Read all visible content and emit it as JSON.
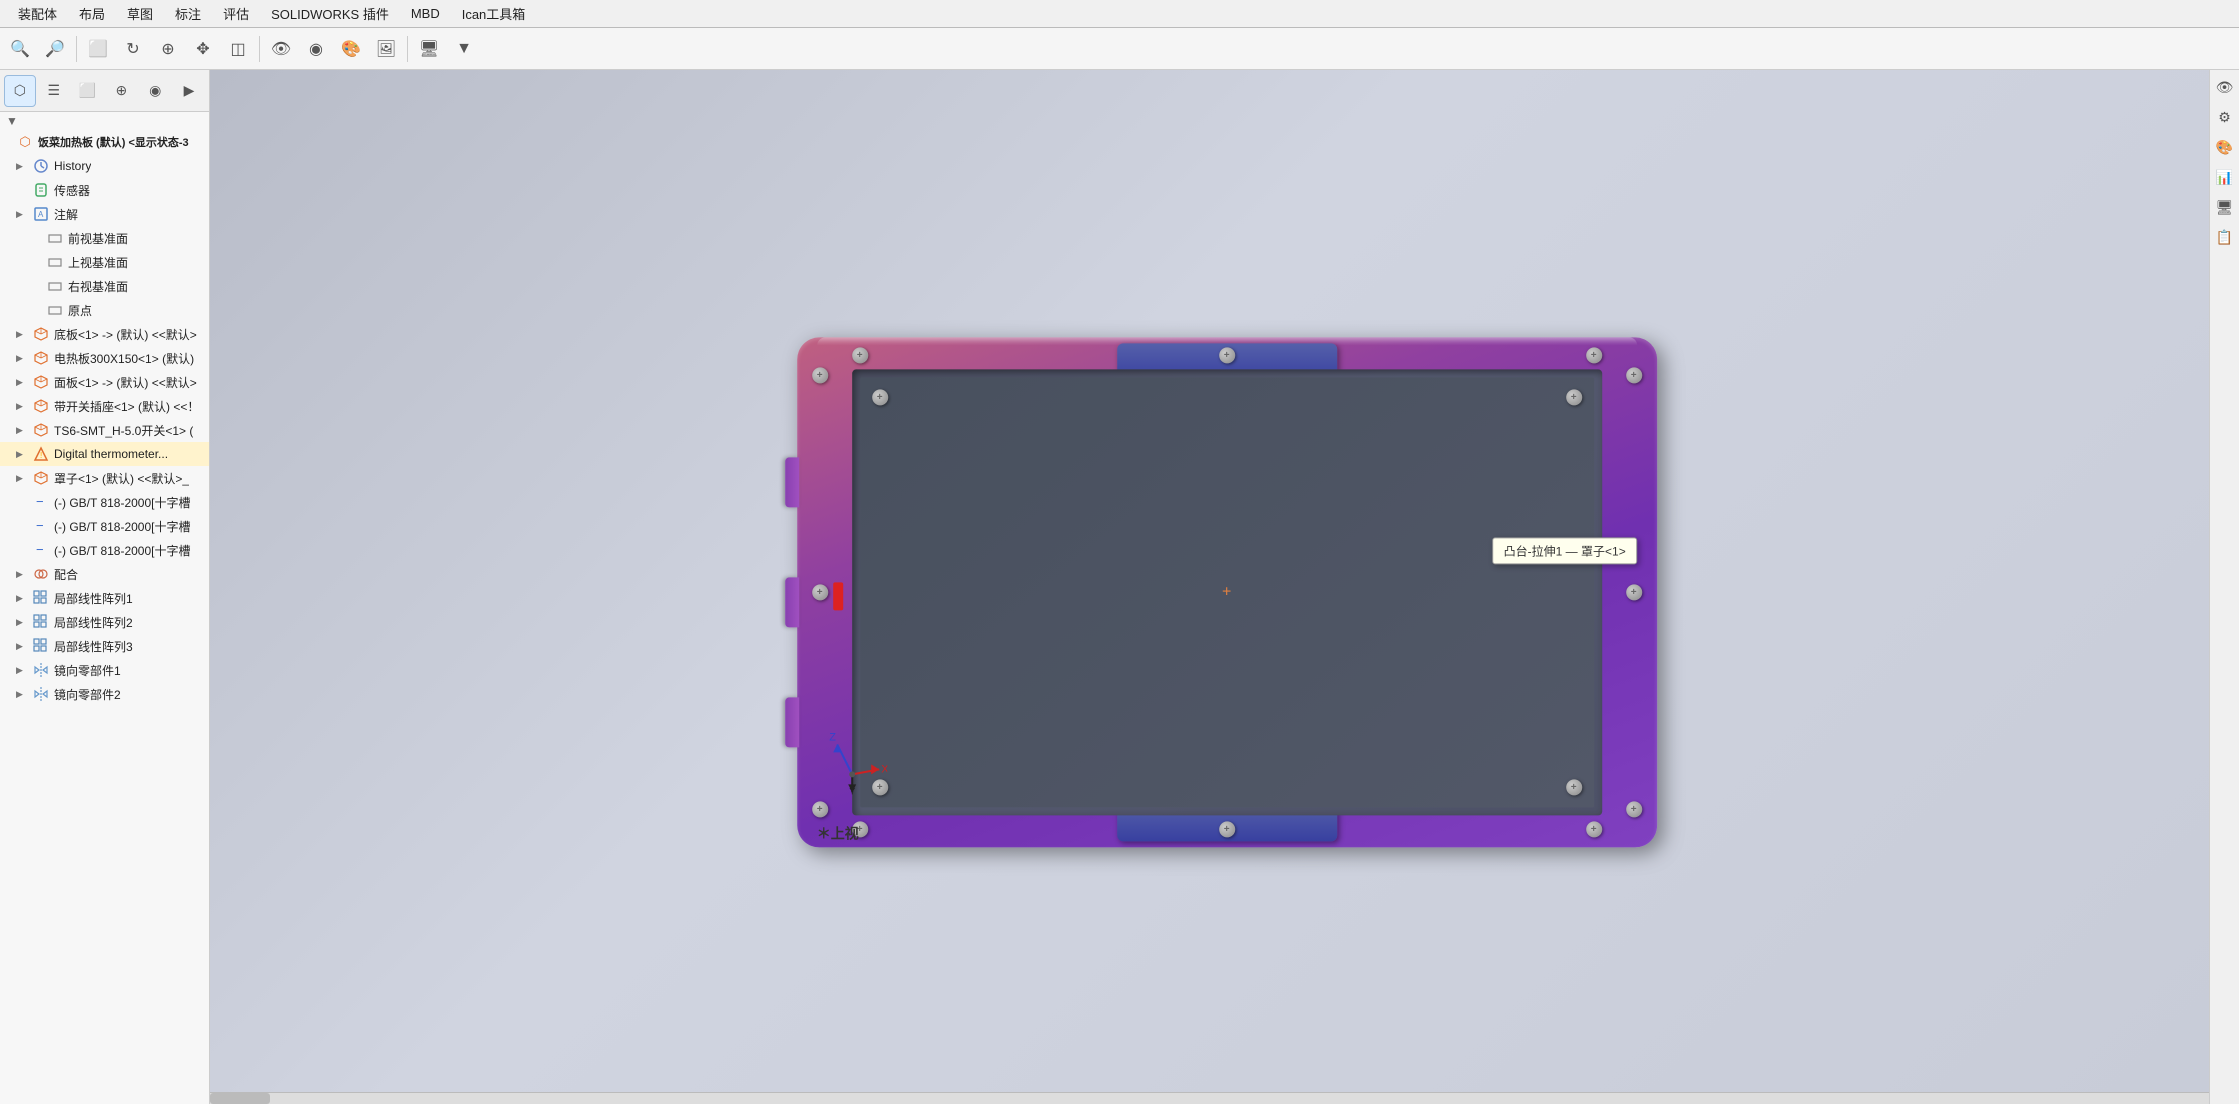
{
  "menubar": {
    "items": [
      "装配体",
      "布局",
      "草图",
      "标注",
      "评估",
      "SOLIDWORKS 插件",
      "MBD",
      "Ican工具箱"
    ]
  },
  "toolbar": {
    "buttons": [
      "⬡",
      "☰",
      "⬜",
      "⊕",
      "◉",
      "▶"
    ]
  },
  "sidebar": {
    "tabs": [
      "⬡",
      "☰",
      "⬜",
      "⊕",
      "◉",
      "▶"
    ],
    "root_label": "饭菜加热板 (默认) <显示状态-3",
    "filter_icon": "▼",
    "items": [
      {
        "id": "history",
        "indent": 0,
        "arrow": "▶",
        "icon": "🕐",
        "icon_class": "icon-history",
        "label": "History"
      },
      {
        "id": "sensor",
        "indent": 0,
        "arrow": "",
        "icon": "◈",
        "icon_class": "icon-sensor",
        "label": "传感器"
      },
      {
        "id": "note",
        "indent": 0,
        "arrow": "▶",
        "icon": "A",
        "icon_class": "icon-note",
        "label": "注解"
      },
      {
        "id": "front-plane",
        "indent": 1,
        "arrow": "",
        "icon": "□",
        "icon_class": "icon-plane",
        "label": "前视基准面"
      },
      {
        "id": "top-plane",
        "indent": 1,
        "arrow": "",
        "icon": "□",
        "icon_class": "icon-plane",
        "label": "上视基准面"
      },
      {
        "id": "right-plane",
        "indent": 1,
        "arrow": "",
        "icon": "□",
        "icon_class": "icon-plane",
        "label": "右视基准面"
      },
      {
        "id": "origin",
        "indent": 1,
        "arrow": "",
        "icon": "↔",
        "icon_class": "icon-origin",
        "label": "原点"
      },
      {
        "id": "part1",
        "indent": 0,
        "arrow": "▶",
        "icon": "⬡",
        "icon_class": "icon-part",
        "label": "底板<1> -> (默认) <<默认>"
      },
      {
        "id": "part2",
        "indent": 0,
        "arrow": "▶",
        "icon": "⬡",
        "icon_class": "icon-part",
        "label": "电热板300X150<1> (默认)"
      },
      {
        "id": "part3",
        "indent": 0,
        "arrow": "▶",
        "icon": "⬡",
        "icon_class": "icon-part",
        "label": "面板<1> -> (默认) <<默认>"
      },
      {
        "id": "part4",
        "indent": 0,
        "arrow": "▶",
        "icon": "⬡",
        "icon_class": "icon-part",
        "label": "带开关插座<1> (默认) <<！"
      },
      {
        "id": "part5",
        "indent": 0,
        "arrow": "▶",
        "icon": "⬡",
        "icon_class": "icon-part",
        "label": "TS6-SMT_H-5.0开关<1> ("
      },
      {
        "id": "part6",
        "indent": 0,
        "arrow": "▶",
        "icon": "⬡",
        "icon_class": "icon-warning",
        "label": "Digital thermometer...",
        "highlight": true
      },
      {
        "id": "part7",
        "indent": 0,
        "arrow": "▶",
        "icon": "⬡",
        "icon_class": "icon-part",
        "label": "罩子<1> (默认) <<默认>_"
      },
      {
        "id": "part8",
        "indent": 0,
        "arrow": "",
        "icon": "−",
        "icon_class": "icon-part-blue",
        "label": "(-) GB/T 818-2000[十字槽"
      },
      {
        "id": "part9",
        "indent": 0,
        "arrow": "",
        "icon": "−",
        "icon_class": "icon-part-blue",
        "label": "(-) GB/T 818-2000[十字槽"
      },
      {
        "id": "part10",
        "indent": 0,
        "arrow": "",
        "icon": "−",
        "icon_class": "icon-part-blue",
        "label": "(-) GB/T 818-2000[十字槽"
      },
      {
        "id": "mate",
        "indent": 0,
        "arrow": "▶",
        "icon": "⊕",
        "icon_class": "icon-mate",
        "label": "配合"
      },
      {
        "id": "pattern1",
        "indent": 0,
        "arrow": "▶",
        "icon": "⊞",
        "icon_class": "icon-pattern",
        "label": "局部线性阵列1"
      },
      {
        "id": "pattern2",
        "indent": 0,
        "arrow": "▶",
        "icon": "⊞",
        "icon_class": "icon-pattern",
        "label": "局部线性阵列2"
      },
      {
        "id": "pattern3",
        "indent": 0,
        "arrow": "▶",
        "icon": "⊞",
        "icon_class": "icon-pattern",
        "label": "局部线性阵列3"
      },
      {
        "id": "mirror1",
        "indent": 0,
        "arrow": "▶",
        "icon": "⊟",
        "icon_class": "icon-mirror",
        "label": "镜向零部件1"
      },
      {
        "id": "mirror2",
        "indent": 0,
        "arrow": "▶",
        "icon": "⊟",
        "icon_class": "icon-mirror",
        "label": "镜向零部件2"
      }
    ]
  },
  "viewport": {
    "tooltip": "凸台-拉伸1 — 罩子<1>",
    "crosshair_color": "#e08040",
    "view_label": "＊上视",
    "axes": {
      "x_color": "#cc3333",
      "y_color": "#3333cc",
      "z_color": "#33aa33"
    }
  },
  "right_panel": {
    "buttons": [
      "👁",
      "⚙",
      "🎨",
      "📊",
      "🖥",
      "📋"
    ]
  }
}
